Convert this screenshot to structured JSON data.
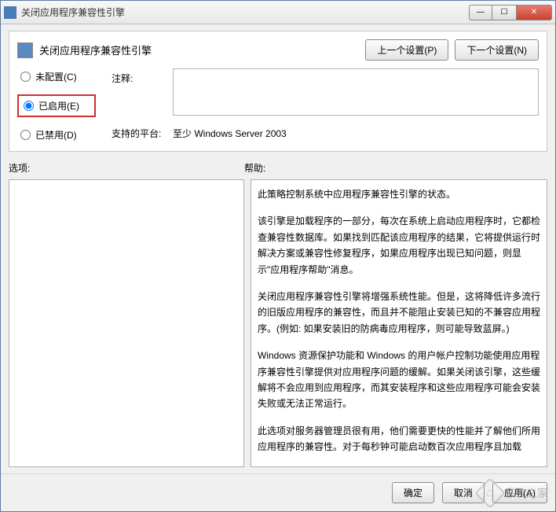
{
  "window": {
    "title": "关闭应用程序兼容性引擎"
  },
  "header": {
    "title": "关闭应用程序兼容性引擎",
    "prev_button": "上一个设置(P)",
    "next_button": "下一个设置(N)"
  },
  "radios": {
    "not_configured": {
      "label": "未配置(C)",
      "hotkey": "C"
    },
    "enabled": {
      "label": "已启用(E)",
      "hotkey": "E",
      "selected": true
    },
    "disabled": {
      "label": "已禁用(D)",
      "hotkey": "D"
    }
  },
  "fields": {
    "comment_label": "注释:",
    "comment_value": "",
    "platform_label": "支持的平台:",
    "platform_value": "至少 Windows Server 2003"
  },
  "panels": {
    "options_label": "选项:",
    "help_label": "帮助:"
  },
  "help": {
    "p1": "此策略控制系统中应用程序兼容性引擎的状态。",
    "p2": "该引擎是加载程序的一部分，每次在系统上启动应用程序时，它都检查兼容性数据库。如果找到匹配该应用程序的结果，它将提供运行时解决方案或兼容性修复程序，如果应用程序出现已知问题，则显示\"应用程序帮助\"消息。",
    "p3": "关闭应用程序兼容性引擎将增强系统性能。但是，这将降低许多流行的旧版应用程序的兼容性，而且并不能阻止安装已知的不兼容应用程序。(例如: 如果安装旧的防病毒应用程序，则可能导致蓝屏。)",
    "p4": "Windows 资源保护功能和 Windows 的用户帐户控制功能使用应用程序兼容性引擎提供对应用程序问题的缓解。如果关闭该引擎，这些缓解将不会应用到应用程序，而其安装程序和这些应用程序可能会安装失败或无法正常运行。",
    "p5": "此选项对服务器管理员很有用，他们需要更快的性能并了解他们所用应用程序的兼容性。对于每秒钟可能启动数百次应用程序且加载"
  },
  "footer": {
    "ok": "确定",
    "cancel": "取消",
    "apply": "应用(A)"
  },
  "watermark": {
    "text": "系统之家"
  }
}
